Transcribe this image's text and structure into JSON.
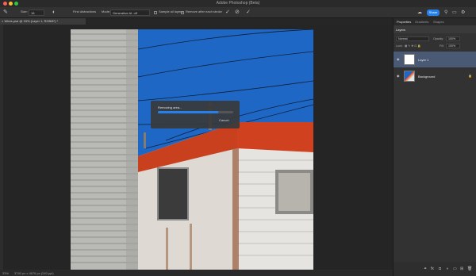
{
  "app": {
    "title": "Adobe Photoshop (Beta)"
  },
  "options_bar": {
    "size_label": "Size:",
    "size_value": "18",
    "find_distractions": "Find distractions",
    "mode_label": "Mode:",
    "mode_value": "Generative AI: off",
    "sample_all_layers": "Sample all layers",
    "remove_after_stroke": "Remove after each stroke",
    "share_label": "Share"
  },
  "document": {
    "tab_title": "× Wires.psd @ 33% (Layer 1, RGB/8*) *"
  },
  "dialog": {
    "title": "Removing area...",
    "cancel_label": "Cancel",
    "progress": 0.8
  },
  "status": {
    "zoom": "33%",
    "doc_info": "3740 px x 4676 px (240 ppi)"
  },
  "panels": {
    "tabs": [
      "Properties",
      "Gradients",
      "Shapes"
    ],
    "layers_tab": "Layers",
    "blend_mode": "Normal",
    "opacity_label": "Opacity:",
    "opacity_value": "100%",
    "lock_label": "Lock:",
    "fill_label": "Fill:",
    "fill_value": "100%",
    "layers": [
      {
        "name": "Layer 1",
        "selected": true
      },
      {
        "name": "Background",
        "selected": false,
        "locked": true
      }
    ]
  },
  "colors": {
    "accent": "#2680eb",
    "sky": "#1f67c4",
    "roof_red": "#d0421f",
    "panel_bg": "#323232"
  }
}
